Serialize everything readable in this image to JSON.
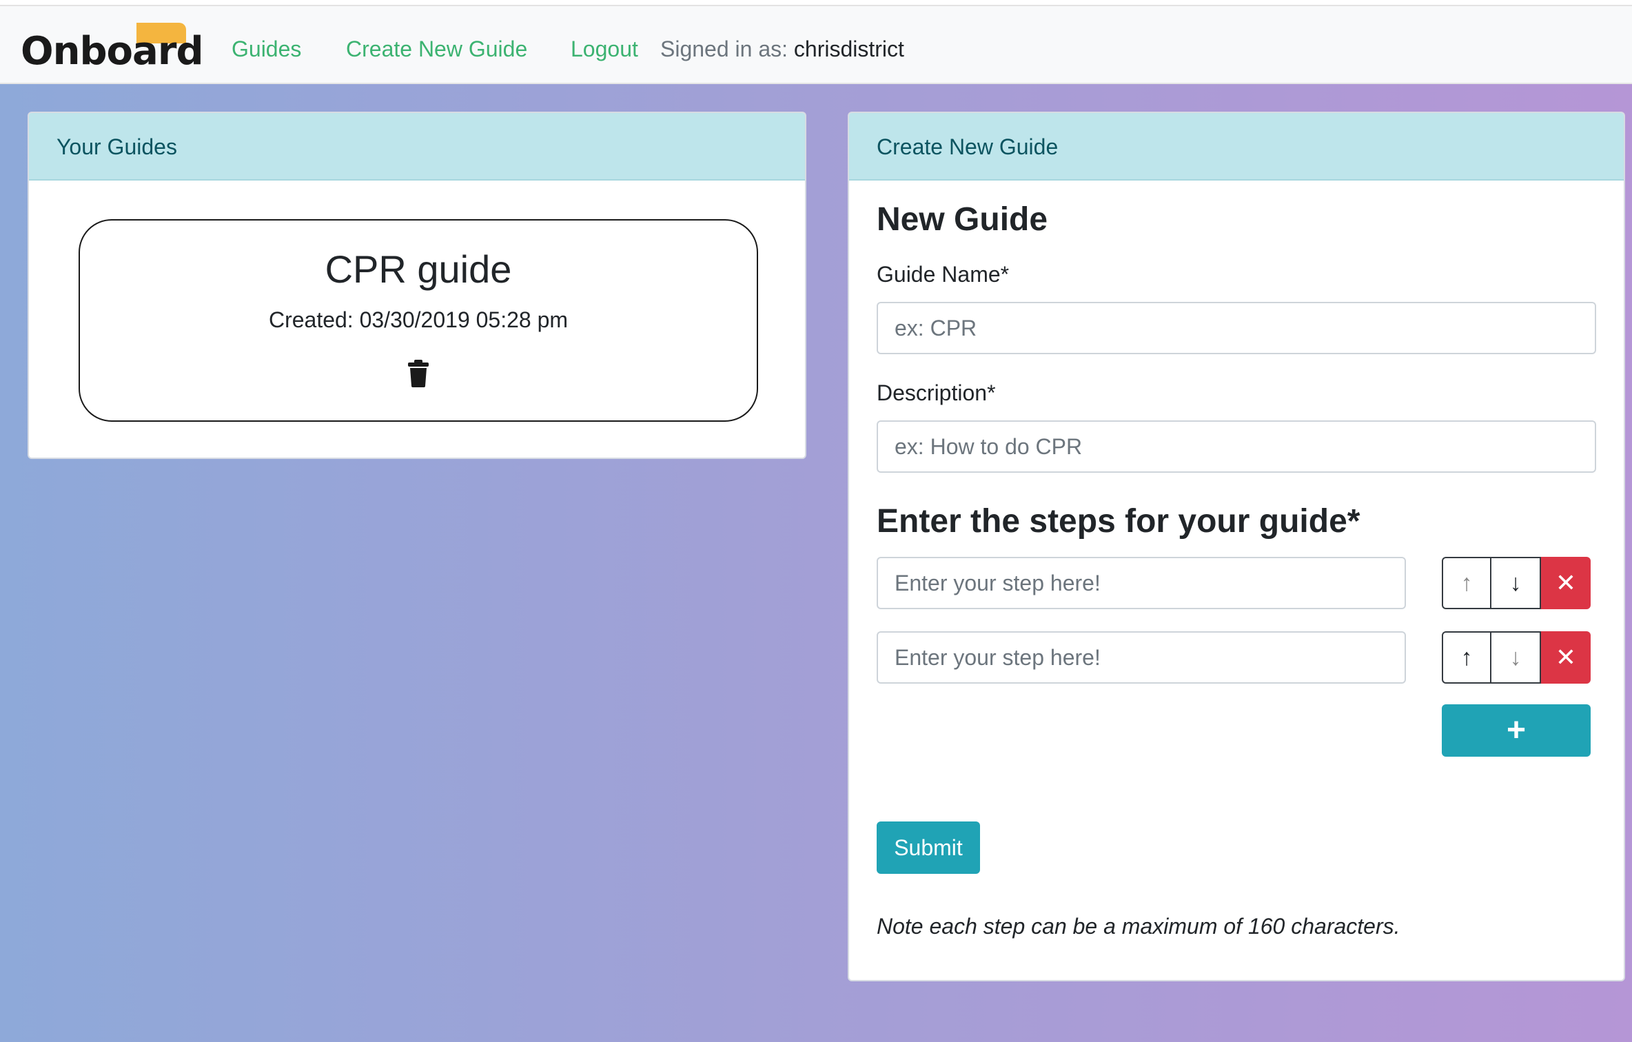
{
  "navbar": {
    "brand": "Onboard",
    "links": [
      "Guides",
      "Create New Guide",
      "Logout"
    ],
    "signed_in_label": "Signed in as:",
    "username": "chrisdistrict",
    "link_color": "#3cb371",
    "brand_accent": "#f4b53f"
  },
  "your_guides": {
    "header": "Your Guides",
    "guides": [
      {
        "title": "CPR guide",
        "created": "Created: 03/30/2019 05:28 pm",
        "icon": "trash-icon"
      }
    ]
  },
  "create_guide": {
    "header": "Create New Guide",
    "form_title": "New Guide",
    "name_label": "Guide Name*",
    "name_placeholder": "ex: CPR",
    "description_label": "Description*",
    "description_placeholder": "ex: How to do CPR",
    "steps_title": "Enter the steps for your guide*",
    "steps": [
      {
        "placeholder": "Enter your step here!",
        "up_icon": "↑",
        "down_icon": "↓",
        "remove_icon": "✕"
      },
      {
        "placeholder": "Enter your step here!",
        "up_icon": "↑",
        "down_icon": "↓",
        "remove_icon": "✕"
      }
    ],
    "add_step_label": "+",
    "submit_label": "Submit",
    "note": "Note each step can be a maximum of 160 characters.",
    "header_bg": "#bee5eb",
    "primary_color": "#20a3b5",
    "danger_color": "#dc3545"
  }
}
